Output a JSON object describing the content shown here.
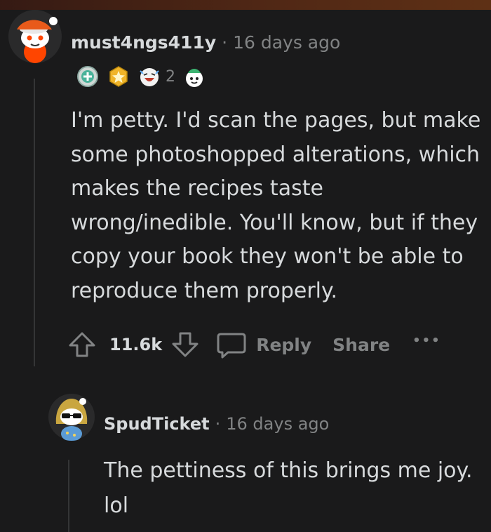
{
  "comments": [
    {
      "author": "must4ngs411y",
      "time": "16 days ago",
      "awards": [
        {
          "icon": "silver-helper-award-icon"
        },
        {
          "icon": "gold-star-award-icon"
        },
        {
          "icon": "laughing-face-award-icon",
          "count": "2"
        },
        {
          "icon": "wholesome-award-icon"
        }
      ],
      "body": "I'm petty. I'd scan the pages, but make some photoshopped alterations, which makes the recipes taste wrong/inedible. You'll know, but if they copy your book they won't be able to reproduce them properly.",
      "score": "11.6k",
      "actions": {
        "reply": "Reply",
        "share": "Share",
        "more": "•••"
      }
    },
    {
      "author": "SpudTicket",
      "time": "16 days ago",
      "body": "The pettiness of this brings me joy. lol"
    }
  ],
  "meta": {
    "separator": "·"
  },
  "colors": {
    "background": "#1a1a1b",
    "text": "#d7dadc",
    "muted": "#818384",
    "thread_line": "#343536"
  }
}
